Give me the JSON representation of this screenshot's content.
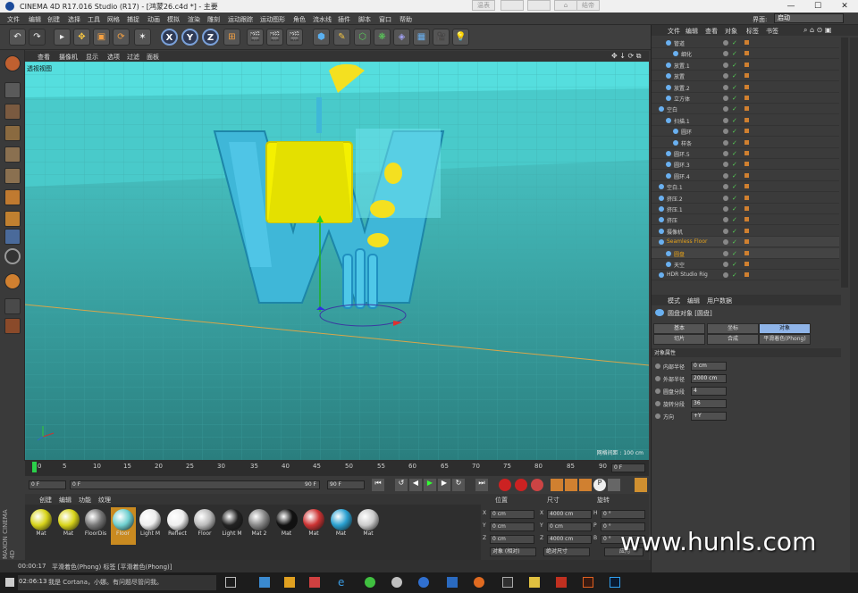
{
  "title": {
    "text": "CINEMA 4D R17.016 Studio (R17) - [鸿蒙26.c4d *] - 主要",
    "top_buttons": [
      "温表",
      "结帝"
    ]
  },
  "menu": [
    "文件",
    "编辑",
    "创建",
    "选择",
    "工具",
    "网格",
    "捕捉",
    "动画",
    "模拟",
    "渲染",
    "雕刻",
    "运动跟踪",
    "运动图形",
    "角色",
    "流水线",
    "插件",
    "脚本",
    "窗口",
    "帮助"
  ],
  "layout": {
    "label": "界面:",
    "value": "启动"
  },
  "viewport": {
    "menu": [
      "查看",
      "摄像机",
      "显示",
      "选项",
      "过滤",
      "面板"
    ],
    "name": "透视视图",
    "grid_info": "网格间距 : 100 cm"
  },
  "toolbar": {
    "axes": [
      "X",
      "Y",
      "Z"
    ]
  },
  "timeline": {
    "ticks": [
      "0",
      "5",
      "10",
      "15",
      "20",
      "25",
      "30",
      "35",
      "40",
      "45",
      "50",
      "55",
      "60",
      "65",
      "70",
      "75",
      "80",
      "85",
      "90"
    ],
    "end": "0 F"
  },
  "playback": {
    "start": "0 F",
    "current": "0 F",
    "end_range": "90 F",
    "end": "90 F"
  },
  "material_menu": [
    "创建",
    "编辑",
    "功能",
    "纹理"
  ],
  "materials": [
    {
      "label": "Mat",
      "color": "#d8d41a"
    },
    {
      "label": "Mat",
      "color": "#d8d41a"
    },
    {
      "label": "FloorDis",
      "color": "#777"
    },
    {
      "label": "Floor",
      "color": "#6fd0d0",
      "selected": true
    },
    {
      "label": "Light M",
      "color": "#eee"
    },
    {
      "label": "Reflect",
      "color": "#eee"
    },
    {
      "label": "Floor",
      "color": "#bbb"
    },
    {
      "label": "Light M",
      "color": "#222"
    },
    {
      "label": "Mat 2",
      "color": "#888"
    },
    {
      "label": "Mat",
      "color": "#111"
    },
    {
      "label": "Mat",
      "color": "#c33"
    },
    {
      "label": "Mat",
      "color": "#2aa0d0"
    },
    {
      "label": "Mat",
      "color": "#ccc"
    }
  ],
  "coords": {
    "headers": [
      "位置",
      "尺寸",
      "旋转"
    ],
    "rows": [
      {
        "axis": "X",
        "pos": "0 cm",
        "size": "4000 cm",
        "rlabel": "H",
        "rot": "0 °"
      },
      {
        "axis": "Y",
        "pos": "0 cm",
        "size": "0 cm",
        "rlabel": "P",
        "rot": "0 °"
      },
      {
        "axis": "Z",
        "pos": "0 cm",
        "size": "4000 cm",
        "rlabel": "B",
        "rot": "0 °"
      }
    ],
    "mode1": "对象 (相对)",
    "mode2": "绝对尺寸",
    "apply": "应用"
  },
  "status": {
    "time": "00:00:17",
    "text": "平滑着色(Phong) 标签 [平滑着色(Phong)]"
  },
  "objects": {
    "menu": [
      "文件",
      "编辑",
      "查看",
      "对象",
      "标签",
      "书签"
    ],
    "items": [
      {
        "name": "管道",
        "indent": 1
      },
      {
        "name": "细化",
        "indent": 2
      },
      {
        "name": "放置.1",
        "indent": 1
      },
      {
        "name": "放置",
        "indent": 1
      },
      {
        "name": "放置.2",
        "indent": 1
      },
      {
        "name": "立方体",
        "indent": 1
      },
      {
        "name": "空白",
        "indent": 0
      },
      {
        "name": "扫描.1",
        "indent": 1
      },
      {
        "name": "圆环",
        "indent": 2
      },
      {
        "name": "样条",
        "indent": 2
      },
      {
        "name": "圆环.5",
        "indent": 1
      },
      {
        "name": "圆环.3",
        "indent": 1
      },
      {
        "name": "圆环.4",
        "indent": 1
      },
      {
        "name": "空白.1",
        "indent": 0
      },
      {
        "name": "挤压.2",
        "indent": 0
      },
      {
        "name": "挤压.1",
        "indent": 0
      },
      {
        "name": "挤压",
        "indent": 0
      },
      {
        "name": "摄像机",
        "indent": 0
      },
      {
        "name": "Seamless Floor",
        "indent": 0,
        "highlight": true
      },
      {
        "name": "圆盘",
        "indent": 1,
        "highlight": true
      },
      {
        "name": "天空",
        "indent": 1
      },
      {
        "name": "HDR Studio Rig",
        "indent": 0
      }
    ]
  },
  "attributes": {
    "menu": [
      "模式",
      "编辑",
      "用户数据"
    ],
    "object_name": "圆盘对象 [圆盘]",
    "tabs": [
      "基本",
      "坐标",
      "对象",
      "切片",
      "合成",
      "平滑着色(Phong)"
    ],
    "section": "对象属性",
    "fields": [
      {
        "label": "内部半径",
        "value": "0 cm"
      },
      {
        "label": "外部半径",
        "value": "2000 cm"
      },
      {
        "label": "圆盘分段",
        "value": "4"
      },
      {
        "label": "旋转分段",
        "value": "36"
      },
      {
        "label": "方向",
        "value": "+Y"
      }
    ]
  },
  "taskbar": {
    "search": "我是 Cortana，小娜。有问题尽管问我。",
    "time": "02:06:13"
  },
  "watermark": "www.hunls.com"
}
